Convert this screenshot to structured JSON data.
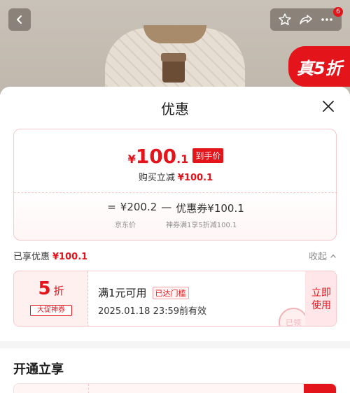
{
  "header": {
    "notification_count": "6",
    "promo_tag": "真5折"
  },
  "sheet": {
    "title": "优惠",
    "summary": {
      "yen": "¥",
      "price_int": "100",
      "price_dec": ".1",
      "arrive_label": "到手价",
      "reduce_text": "购买立减",
      "reduce_amount": "¥100.1",
      "formula_equals": "=",
      "jd_price": "¥200.2",
      "formula_minus": "—",
      "coupon_text": "优惠券¥100.1",
      "jd_price_label": "京东价",
      "coupon_desc": "神券满1享5折减100.1"
    },
    "enjoyed": {
      "label": "已享优惠",
      "amount": "¥100.1",
      "collapse_label": "收起"
    },
    "coupon": {
      "discount": "5",
      "discount_unit": "折",
      "type_tag": "大促神券",
      "condition": "满1元可用",
      "reached_tag": "已达门槛",
      "expiry": "2025.01.18 23:59前有效",
      "stamp": "已领",
      "use_label": "立即使用"
    },
    "section_title": "开通立享"
  },
  "colors": {
    "accent_red": "#e4141b",
    "coupon_bg": "#fff0f0"
  }
}
